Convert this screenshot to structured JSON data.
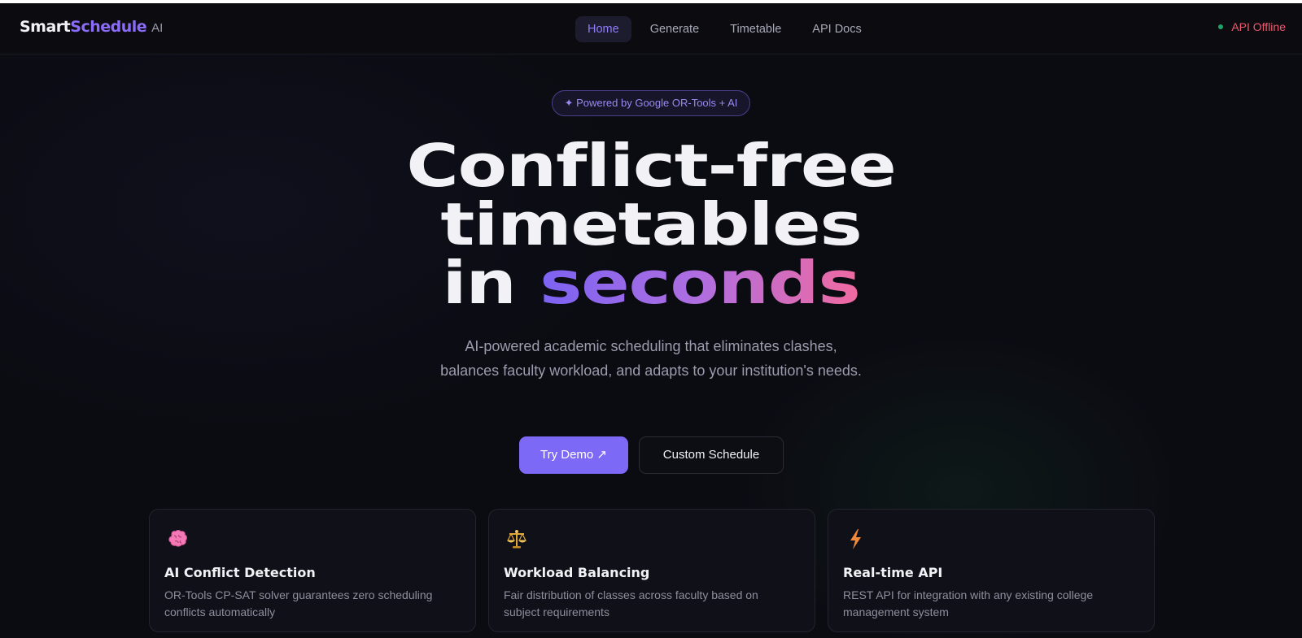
{
  "brand": {
    "name_a": "Smart",
    "name_b": "Schedule",
    "suffix": "AI"
  },
  "nav": {
    "links": [
      {
        "label": "Home"
      },
      {
        "label": "Generate"
      },
      {
        "label": "Timetable"
      },
      {
        "label": "API Docs"
      }
    ],
    "active_index": 0
  },
  "api_status": {
    "label": "API Offline",
    "dot_color": "#1fa36b",
    "text_color": "#ef5a6f"
  },
  "hero": {
    "badge": "✦ Powered by Google OR-Tools + AI",
    "headline_line1": "Conflict-free",
    "headline_line2": "timetables",
    "headline_line3_plain": "in ",
    "headline_line3_accent": "seconds",
    "subtitle": "AI-powered academic scheduling that eliminates clashes, balances faculty workload, and adapts to your institution's needs.",
    "primary_button": "Try Demo ↗",
    "secondary_button": "Custom Schedule"
  },
  "features": [
    {
      "icon": "brain-icon",
      "title": "AI Conflict Detection",
      "description": "OR-Tools CP-SAT solver guarantees zero scheduling conflicts automatically"
    },
    {
      "icon": "scales-icon",
      "title": "Workload Balancing",
      "description": "Fair distribution of classes across faculty based on subject requirements"
    },
    {
      "icon": "lightning-icon",
      "title": "Real-time API",
      "description": "REST API for integration with any existing college management system"
    }
  ],
  "colors": {
    "accent": "#7c6af7",
    "background": "#0b0b12",
    "card": "#101018"
  }
}
